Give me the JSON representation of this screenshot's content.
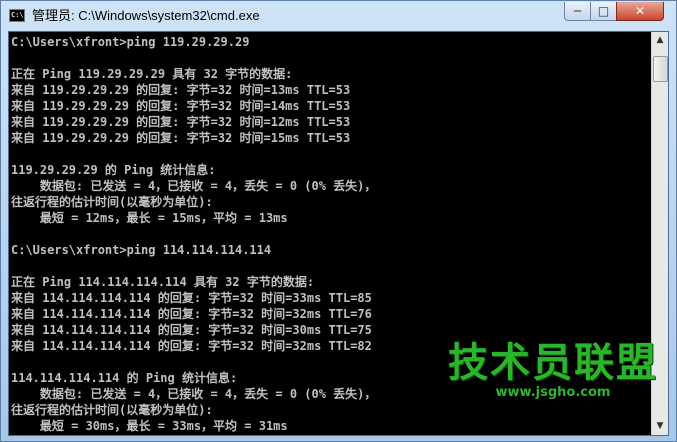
{
  "window": {
    "title": "管理员: C:\\Windows\\system32\\cmd.exe",
    "controls": {
      "minimize": "─",
      "maximize": "□",
      "close": "✕"
    }
  },
  "console": {
    "lines": [
      "C:\\Users\\xfront>ping 119.29.29.29",
      "",
      "正在 Ping 119.29.29.29 具有 32 字节的数据:",
      "来自 119.29.29.29 的回复: 字节=32 时间=13ms TTL=53",
      "来自 119.29.29.29 的回复: 字节=32 时间=14ms TTL=53",
      "来自 119.29.29.29 的回复: 字节=32 时间=12ms TTL=53",
      "来自 119.29.29.29 的回复: 字节=32 时间=15ms TTL=53",
      "",
      "119.29.29.29 的 Ping 统计信息:",
      "    数据包: 已发送 = 4，已接收 = 4，丢失 = 0 (0% 丢失)，",
      "往返行程的估计时间(以毫秒为单位):",
      "    最短 = 12ms，最长 = 15ms，平均 = 13ms",
      "",
      "C:\\Users\\xfront>ping 114.114.114.114",
      "",
      "正在 Ping 114.114.114.114 具有 32 字节的数据:",
      "来自 114.114.114.114 的回复: 字节=32 时间=33ms TTL=85",
      "来自 114.114.114.114 的回复: 字节=32 时间=32ms TTL=76",
      "来自 114.114.114.114 的回复: 字节=32 时间=30ms TTL=75",
      "来自 114.114.114.114 的回复: 字节=32 时间=32ms TTL=82",
      "",
      "114.114.114.114 的 Ping 统计信息:",
      "    数据包: 已发送 = 4，已接收 = 4，丢失 = 0 (0% 丢失)，",
      "往返行程的估计时间(以毫秒为单位):",
      "    最短 = 30ms，最长 = 33ms，平均 = 31ms"
    ]
  },
  "scrollbar": {
    "up": "▲",
    "down": "▼"
  },
  "watermark": {
    "title": "技术员联盟",
    "url": "www.jsgho.com"
  },
  "colors": {
    "console_bg": "#000000",
    "console_text": "#c0c0c0",
    "watermark": "#2bb52b"
  }
}
